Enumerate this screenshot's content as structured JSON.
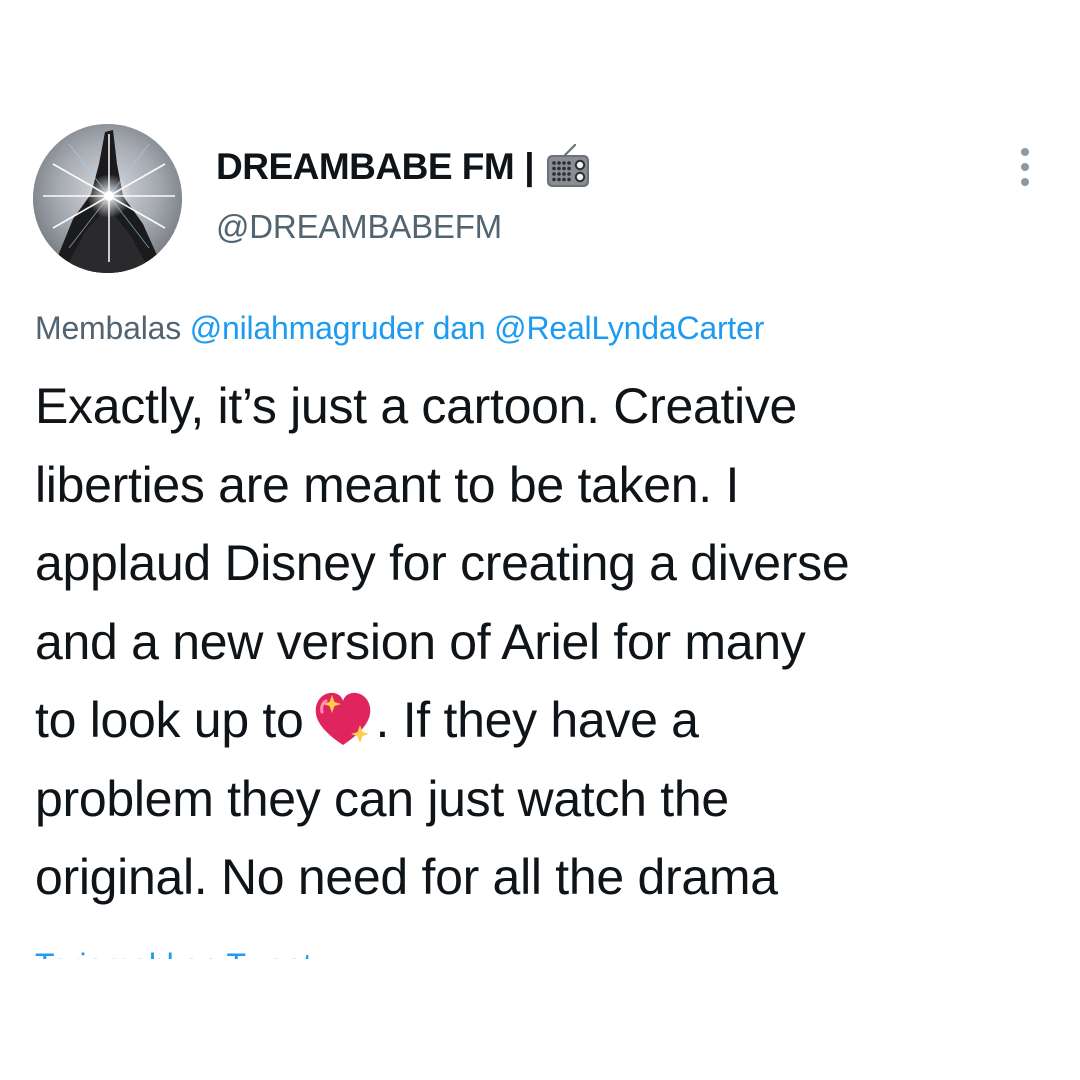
{
  "user": {
    "display_name": "DREAMBABE FM",
    "name_separator": "|",
    "name_emoji": "radio-icon",
    "handle": "@DREAMBABEFM"
  },
  "reply_context": {
    "prefix": "Membalas",
    "mention_1": "@nilahmagruder",
    "joiner": "dan",
    "mention_2": "@RealLyndaCarter"
  },
  "tweet": {
    "line_1": "Exactly, it’s just a cartoon. Creative",
    "line_2": "liberties are meant to be taken. I",
    "line_3": "applaud Disney for creating a diverse",
    "line_4": "and a new version of Ariel for many",
    "line_5_before_emoji": "to look up to",
    "line_5_emoji": "sparkling-heart-icon",
    "line_5_after_emoji": ". If they have a",
    "line_6": "problem they can just watch the",
    "line_7": "original. No need for all the drama"
  },
  "translate_link": "Terjemahkan Tweet",
  "colors": {
    "text": "#0f1419",
    "secondary": "#536471",
    "link": "#1d9bf0",
    "heart": "#e0245e"
  }
}
